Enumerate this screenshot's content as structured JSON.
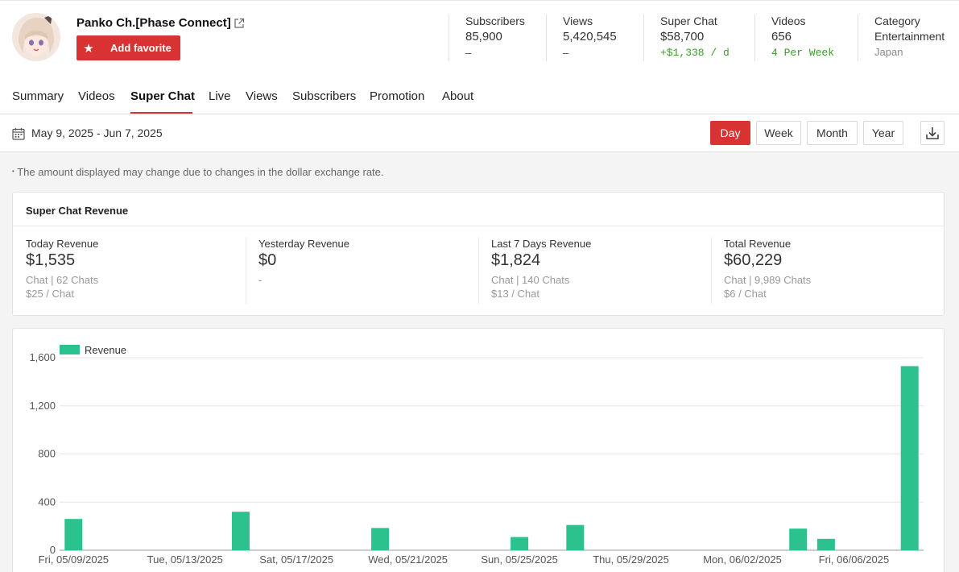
{
  "channel": {
    "name": "Panko Ch.[Phase Connect]",
    "favorite_label": "Add favorite"
  },
  "stats": [
    {
      "header": "Subscribers",
      "value": "85,900",
      "sub": "–",
      "sub_style": "plain"
    },
    {
      "header": "Views",
      "value": "5,420,545",
      "sub": "–",
      "sub_style": "plain"
    },
    {
      "header": "Super Chat",
      "value": "$58,700",
      "sub": "+$1,338 / d",
      "sub_style": "green"
    },
    {
      "header": "Videos",
      "value": "656",
      "sub": "4 Per Week",
      "sub_style": "green"
    },
    {
      "header": "Category",
      "value": "Entertainment",
      "sub": "Japan",
      "sub_style": "gray"
    }
  ],
  "tabs": [
    {
      "label": "Summary",
      "active": false
    },
    {
      "label": "Videos",
      "active": false
    },
    {
      "label": "Super Chat",
      "active": true
    },
    {
      "label": "Live",
      "active": false
    },
    {
      "label": "Views",
      "active": false
    },
    {
      "label": "Subscribers",
      "active": false
    },
    {
      "label": "Promotion",
      "active": false
    },
    {
      "label": "About",
      "active": false
    }
  ],
  "date_range": "May 9, 2025 - Jun 7, 2025",
  "periods": [
    {
      "label": "Day",
      "active": true
    },
    {
      "label": "Week",
      "active": false
    },
    {
      "label": "Month",
      "active": false
    },
    {
      "label": "Year",
      "active": false
    }
  ],
  "note": "The amount displayed may change due to changes in the dollar exchange rate.",
  "revenue": {
    "title": "Super Chat Revenue",
    "items": [
      {
        "header": "Today Revenue",
        "value": "$1,535",
        "line1": "Chat | 62 Chats",
        "line2": "$25 / Chat"
      },
      {
        "header": "Yesterday Revenue",
        "value": "$0",
        "line1": "-",
        "line2": ""
      },
      {
        "header": "Last 7 Days Revenue",
        "value": "$1,824",
        "line1": "Chat | 140 Chats",
        "line2": "$13 / Chat"
      },
      {
        "header": "Total Revenue",
        "value": "$60,229",
        "line1": "Chat | 9,989 Chats",
        "line2": "$6 / Chat"
      }
    ]
  },
  "colors": {
    "accent": "#d93232",
    "bar": "#2bc28e",
    "green_text": "#3b9b2b"
  },
  "chart_data": {
    "type": "bar",
    "series": [
      {
        "name": "Revenue",
        "values": [
          260,
          0,
          0,
          0,
          0,
          0,
          320,
          0,
          0,
          0,
          0,
          185,
          0,
          0,
          0,
          0,
          110,
          0,
          210,
          0,
          0,
          0,
          0,
          0,
          0,
          0,
          180,
          95,
          0,
          0,
          1530
        ]
      }
    ],
    "x": [
      "05/09",
      "05/10",
      "05/11",
      "05/12",
      "05/13",
      "05/14",
      "05/15",
      "05/16",
      "05/17",
      "05/18",
      "05/19",
      "05/20",
      "05/21",
      "05/22",
      "05/23",
      "05/24",
      "05/25",
      "05/26",
      "05/27",
      "05/28",
      "05/29",
      "05/30",
      "05/31",
      "06/01",
      "06/02",
      "06/03",
      "06/04",
      "06/05",
      "06/06",
      "06/07",
      "06/07b"
    ],
    "tick_labels": [
      "Fri, 05/09/2025",
      "Tue, 05/13/2025",
      "Sat, 05/17/2025",
      "Wed, 05/21/2025",
      "Sun, 05/25/2025",
      "Thu, 05/29/2025",
      "Mon, 06/02/2025",
      "Fri, 06/06/2025"
    ],
    "y_ticks": [
      "0",
      "400",
      "800",
      "1,200",
      "1,600"
    ],
    "ylim": [
      0,
      1600
    ],
    "grid": true,
    "legend": "top-left"
  }
}
